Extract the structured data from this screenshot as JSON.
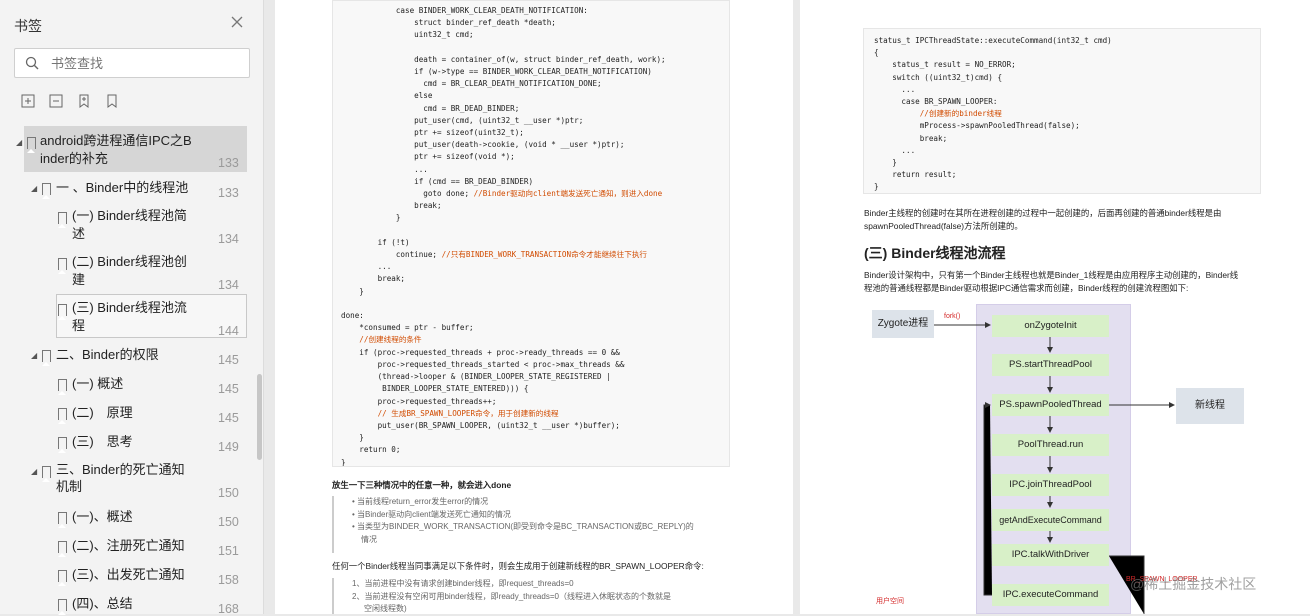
{
  "sidebar": {
    "title": "书签",
    "search_placeholder": "书签查找",
    "items": [
      {
        "label_lines": [
          "android跨进程通信IPC之B",
          "inder的补充"
        ],
        "page": "133"
      },
      {
        "label_lines": [
          "一 、Binder中的线程池"
        ],
        "page": "133"
      },
      {
        "label_lines": [
          "(一) Binder线程池简",
          "述"
        ],
        "page": "134"
      },
      {
        "label_lines": [
          "(二) Binder线程池创",
          "建"
        ],
        "page": "134"
      },
      {
        "label_lines": [
          "(三) Binder线程池流",
          "程"
        ],
        "page": "144"
      },
      {
        "label_lines": [
          "二、Binder的权限"
        ],
        "page": "145"
      },
      {
        "label_lines": [
          "(一) 概述"
        ],
        "page": "145"
      },
      {
        "label_lines": [
          "(二)　原理"
        ],
        "page": "145"
      },
      {
        "label_lines": [
          "(三)　思考"
        ],
        "page": "149"
      },
      {
        "label_lines": [
          "三、Binder的死亡通知",
          "机制"
        ],
        "page": "150"
      },
      {
        "label_lines": [
          "(一)、概述"
        ],
        "page": "150"
      },
      {
        "label_lines": [
          "(二)、注册死亡通知"
        ],
        "page": "151"
      },
      {
        "label_lines": [
          "(三)、出发死亡通知"
        ],
        "page": "158"
      },
      {
        "label_lines": [
          "(四)、总结"
        ],
        "page": "168"
      }
    ]
  },
  "left_page": {
    "code_lines": [
      "            case BINDER_WORK_CLEAR_DEATH_NOTIFICATION:",
      "                struct binder_ref_death *death;",
      "                uint32_t cmd;",
      "",
      "                death = container_of(w, struct binder_ref_death, work);",
      "                if (w->type == BINDER_WORK_CLEAR_DEATH_NOTIFICATION)",
      "                  cmd = BR_CLEAR_DEATH_NOTIFICATION_DONE;",
      "                else",
      "                  cmd = BR_DEAD_BINDER;",
      "                put_user(cmd, (uint32_t __user *)ptr;",
      "                ptr += sizeof(uint32_t);",
      "                put_user(death->cookie, (void * __user *)ptr);",
      "                ptr += sizeof(void *);",
      "                ...",
      "                if (cmd == BR_DEAD_BINDER)",
      "                  goto done; //Binder驱动向client端发送死亡通知，则进入done",
      "                break;",
      "            }",
      "",
      "        if (!t)",
      "            continue; //只有BINDER_WORK_TRANSACTION命令才能继续往下执行",
      "        ...",
      "        break;",
      "    }",
      "",
      "done:",
      "    *consumed = ptr - buffer;",
      "    //创建线程的条件",
      "    if (proc->requested_threads + proc->ready_threads == 0 &&",
      "        proc->requested_threads_started < proc->max_threads &&",
      "        (thread->looper & (BINDER_LOOPER_STATE_REGISTERED |",
      "         BINDER_LOOPER_STATE_ENTERED))) {",
      "        proc->requested_threads++;",
      "        // 生成BR_SPAWN_LOOPER命令，用于创建新的线程",
      "        put_user(BR_SPAWN_LOOPER, (uint32_t __user *)buffer);",
      "    }",
      "    return 0;",
      "}"
    ],
    "para1": "放生一下三种情况中的任意一种，就会进入done",
    "quote_items": [
      "当前线程return_error发生error的情况",
      "当Binder驱动向client端发送死亡通知的情况",
      "当类型为BINDER_WORK_TRANSACTION(即受到命令是BC_TRANSACTION或BC_REPLY)的",
      "情况"
    ],
    "para2": "任何一个Binder线程当同事满足以下条件时，则会生成用于创建新线程的BR_SPAWN_LOOPER命令:",
    "cond_items": [
      "1、当前进程中没有请求创建binder线程，即request_threads=0",
      "2、当前进程没有空闲可用binder线程，即ready_threads=0（线程进入休眠状态的个数就是",
      "空闲线程数)"
    ]
  },
  "right_page": {
    "code_lines": [
      "status_t IPCThreadState::executeCommand(int32_t cmd)",
      "{",
      "    status_t result = NO_ERROR;",
      "    switch ((uint32_t)cmd) {",
      "      ...",
      "      case BR_SPAWN_LOOPER:",
      "          //创建新的binder线程",
      "          mProcess->spawnPooledThread(false);",
      "          break;",
      "      ...",
      "    }",
      "    return result;",
      "}"
    ],
    "para1_lines": [
      "Binder主线程的创建时在其所在进程创建的过程中一起创建的，后面再创建的普通binder线程是由",
      "spawnPooledThread(false)方法所创建的。"
    ],
    "heading": "(三) Binder线程池流程",
    "para2_lines": [
      "Binder设计架构中，只有第一个Binder主线程也就是Binder_1线程是由应用程序主动创建的，Binder线",
      "程池的普通线程都是Binder驱动根据IPC通信需求而创建，Binder线程的创建流程图如下:"
    ],
    "flow": {
      "zygote": "Zygote进程",
      "fork_label": "fork()",
      "steps": [
        "onZygoteInit",
        "PS.startThreadPool",
        "PS.spawnPooledThread",
        "PoolThread.run",
        "IPC.joinThreadPool",
        "getAndExecuteCommand",
        "IPC.talkWithDriver",
        "IPC.executeCommand"
      ],
      "new_thread": "新线程",
      "user_space": "用户空间",
      "br_label": "BR_SPAWN_LOOPER"
    }
  },
  "watermark": "@稀土掘金技术社区"
}
